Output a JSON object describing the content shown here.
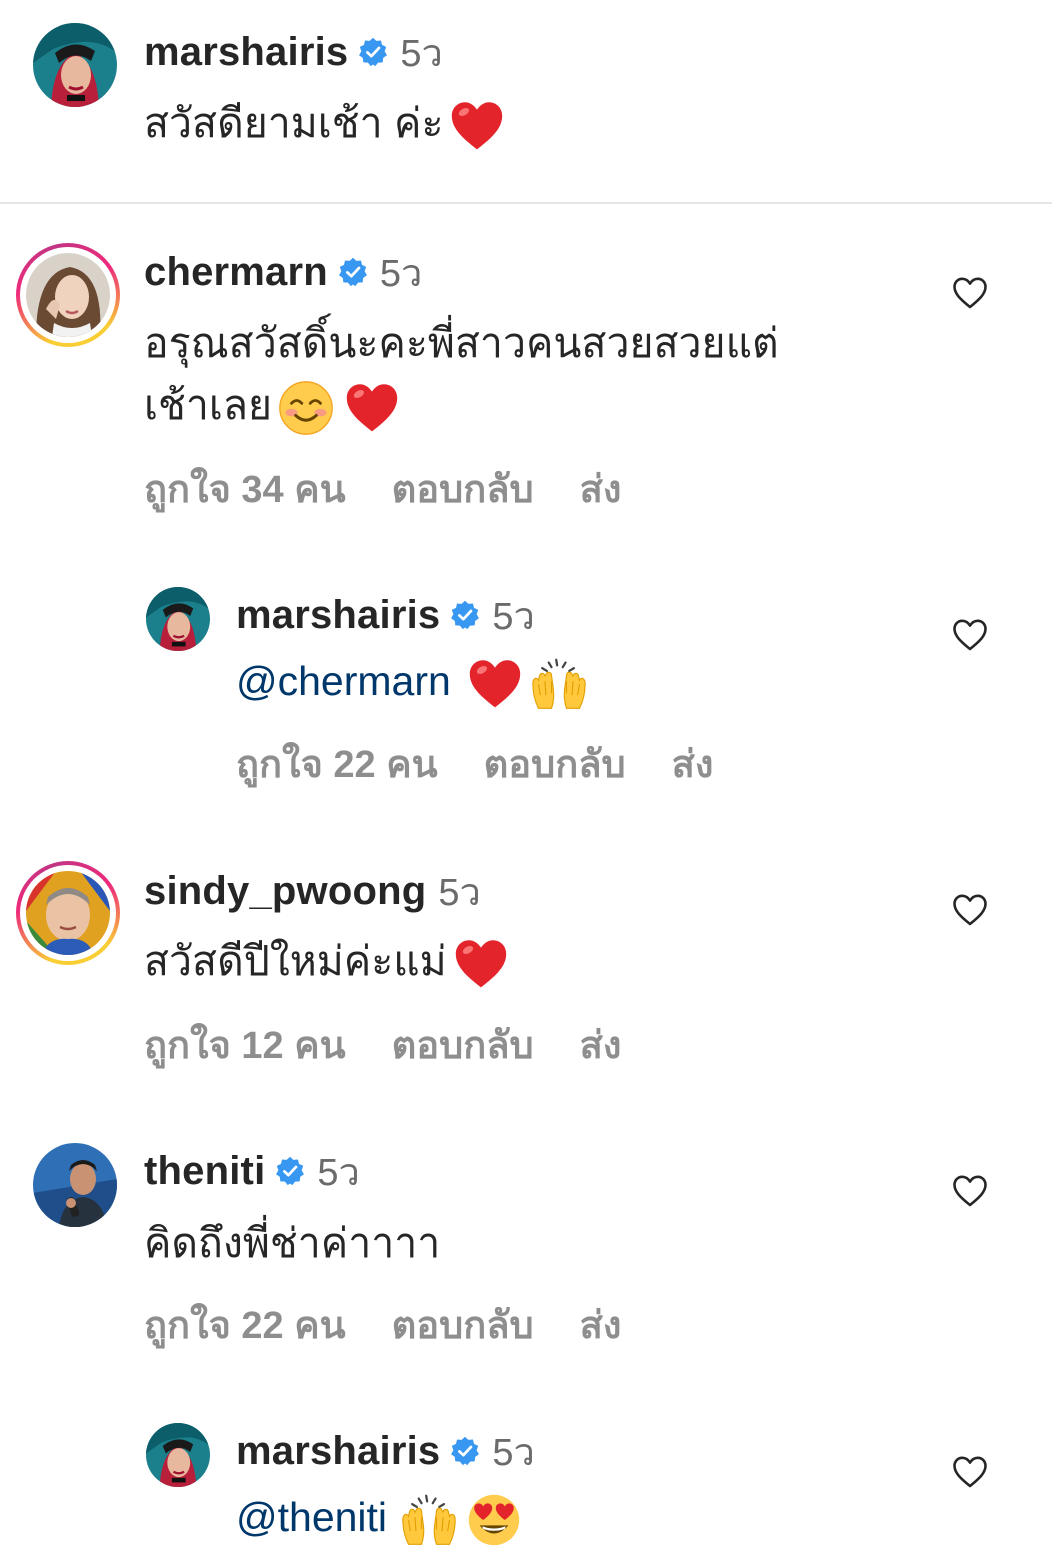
{
  "comments": [
    {
      "username": "marshairis",
      "verified": true,
      "time": "5ว",
      "text": "สวัสดียามเช้า ค่ะ",
      "emojis": [
        "red-heart"
      ]
    },
    {
      "username": "chermarn",
      "verified": true,
      "time": "5ว",
      "text_line1": "อรุณสวัสดิ์นะคะพี่สาวคนสวยสวยแต่",
      "text_line2": "เช้าเลย",
      "emojis": [
        "smiling-face",
        "red-heart"
      ],
      "likes": "ถูกใจ 34 คน",
      "reply": "ตอบกลับ",
      "send": "ส่ง"
    },
    {
      "username": "marshairis",
      "verified": true,
      "time": "5ว",
      "mention": "@chermarn",
      "emojis": [
        "red-heart",
        "raising-hands"
      ],
      "likes": "ถูกใจ 22 คน",
      "reply": "ตอบกลับ",
      "send": "ส่ง"
    },
    {
      "username": "sindy_pwoong",
      "verified": false,
      "time": "5ว",
      "text": "สวัสดีปีใหม่ค่ะแม่",
      "emojis": [
        "red-heart"
      ],
      "likes": "ถูกใจ 12 คน",
      "reply": "ตอบกลับ",
      "send": "ส่ง"
    },
    {
      "username": "theniti",
      "verified": true,
      "time": "5ว",
      "text": "คิดถึงพี่ช่าค่าาาา",
      "likes": "ถูกใจ 22 คน",
      "reply": "ตอบกลับ",
      "send": "ส่ง"
    },
    {
      "username": "marshairis",
      "verified": true,
      "time": "5ว",
      "mention": "@theniti",
      "emojis": [
        "raising-hands",
        "heart-eyes-face"
      ]
    }
  ],
  "colors": {
    "text": "#262626",
    "muted": "#8e8e8e",
    "mention": "#00376b",
    "verified": "#3897f0",
    "heart": "#e0245e"
  }
}
